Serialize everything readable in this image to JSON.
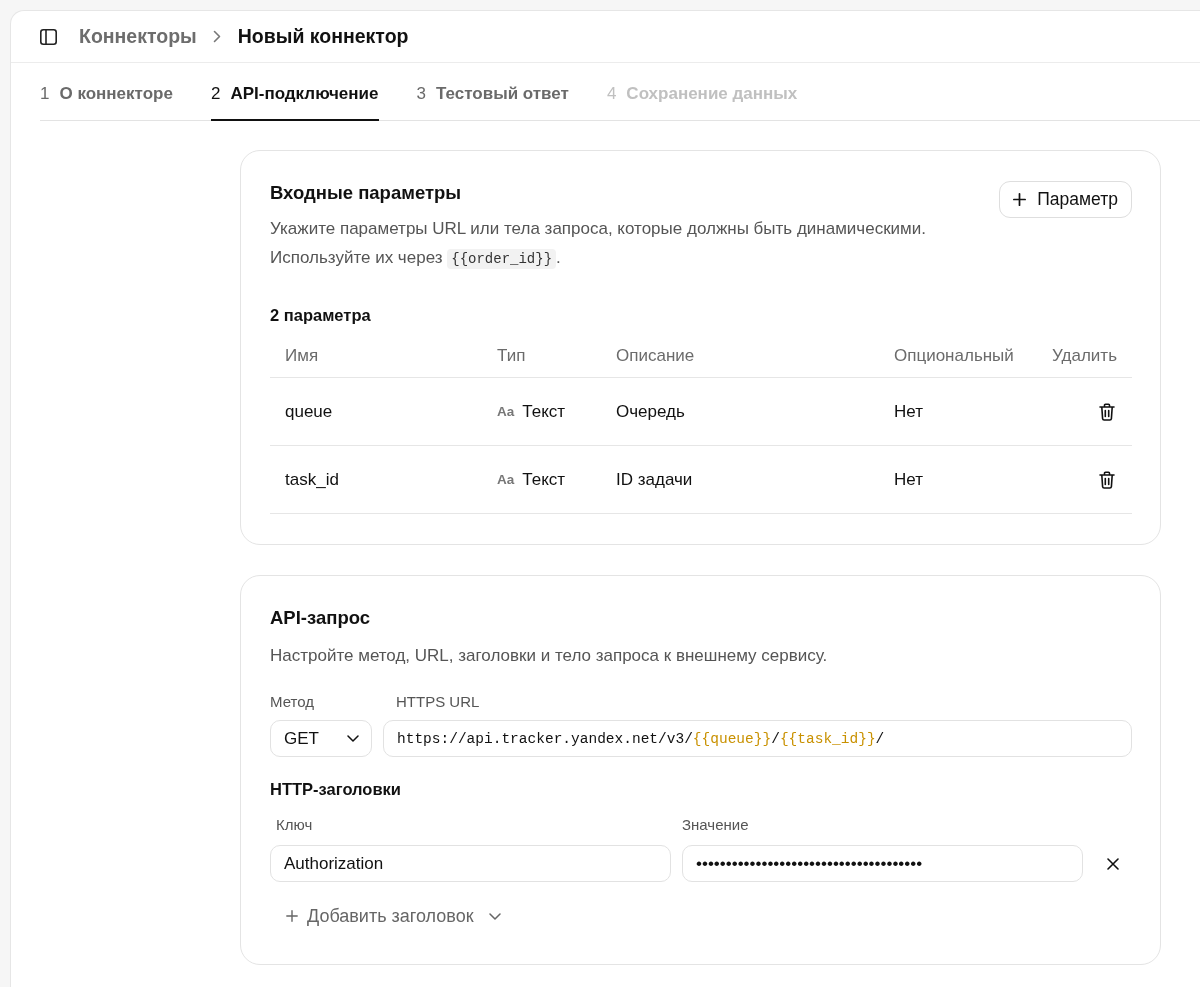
{
  "header": {
    "breadcrumbs": [
      {
        "label": "Коннекторы",
        "current": false
      },
      {
        "label": "Новый коннектор",
        "current": true
      }
    ]
  },
  "tabs": [
    {
      "number": "1",
      "label": "О коннекторе",
      "selected": false,
      "disabled": false
    },
    {
      "number": "2",
      "label": "API-подключение",
      "selected": true,
      "disabled": false
    },
    {
      "number": "3",
      "label": "Тестовый ответ",
      "selected": false,
      "disabled": false
    },
    {
      "number": "4",
      "label": "Сохранение данных",
      "selected": false,
      "disabled": true
    }
  ],
  "input_params": {
    "title": "Входные параметры",
    "add_button": "Параметр",
    "description": [
      [
        {
          "kind": "text",
          "text": "Укажите параметры URL или тела запроса, которые должны быть динамическими."
        }
      ],
      [
        {
          "kind": "text",
          "text": "Используйте их через "
        },
        {
          "kind": "code",
          "text": "{{order_id}}"
        },
        {
          "kind": "text",
          "text": "."
        }
      ]
    ],
    "count": "2 параметра",
    "table": {
      "columns": [
        "Имя",
        "Тип",
        "Описание",
        "Опциональный",
        "Удалить"
      ],
      "rows": [
        {
          "name": "queue",
          "type_icon": "Aa",
          "type": "Текст",
          "description": "Очередь",
          "optional": "Нет"
        },
        {
          "name": "task_id",
          "type_icon": "Aa",
          "type": "Текст",
          "description": "ID задачи",
          "optional": "Нет"
        }
      ]
    }
  },
  "api_request": {
    "title": "API-запрос",
    "description": "Настройте метод, URL, заголовки и тело запроса к внешнему сервису.",
    "method_label": "Метод",
    "method": "GET",
    "url_label": "HTTPS URL",
    "url": [
      {
        "kind": "plain",
        "text": "https://api.tracker.yandex.net/v3/"
      },
      {
        "kind": "variable",
        "text": "{{queue}}"
      },
      {
        "kind": "plain",
        "text": "/"
      },
      {
        "kind": "variable",
        "text": "{{task_id}}"
      },
      {
        "kind": "plain",
        "text": "/"
      }
    ],
    "headers_title": "HTTP-заголовки",
    "key_label": "Ключ",
    "value_label": "Значение",
    "headers": [
      {
        "key": "Authorization",
        "value": "••••••••••••••••••••••••••••••••••••••"
      }
    ],
    "add_header_button": "Добавить заголовок"
  }
}
